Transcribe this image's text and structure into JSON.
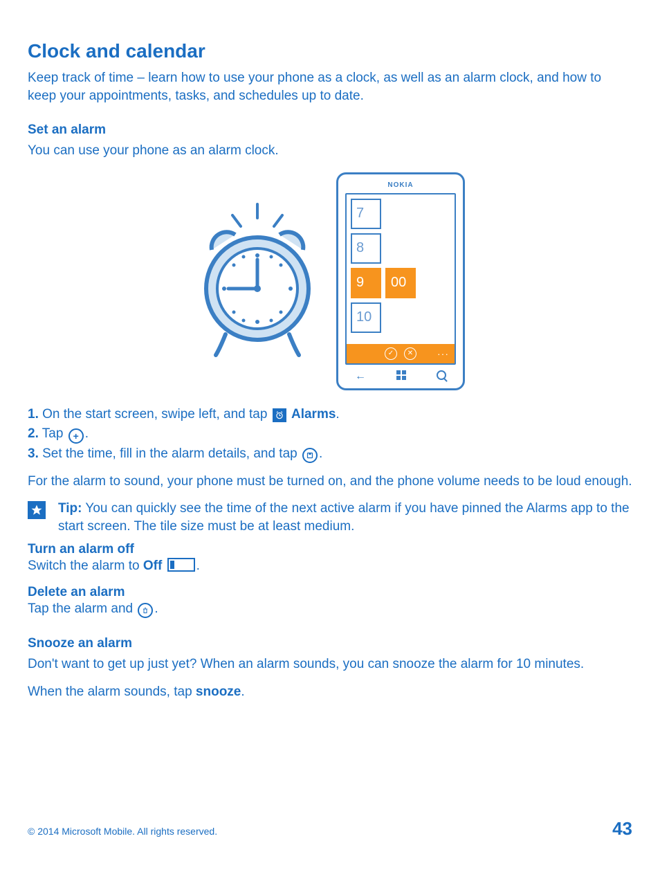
{
  "h1": "Clock and calendar",
  "intro": "Keep track of time – learn how to use your phone as a clock, as well as an alarm clock, and how to keep your appointments, tasks, and schedules up to date.",
  "set_alarm": {
    "heading": "Set an alarm",
    "lead": "You can use your phone as an alarm clock.",
    "step1_num": "1.",
    "step1_a": " On the start screen, swipe left, and tap ",
    "step1_b": "Alarms",
    "step1_c": ".",
    "step2_num": "2.",
    "step2_a": " Tap ",
    "step2_c": ".",
    "step3_num": "3.",
    "step3_a": " Set the time, fill in the alarm details, and tap ",
    "step3_c": ".",
    "note": "For the alarm to sound, your phone must be turned on, and the phone volume needs to be loud enough.",
    "tip_label": "Tip:",
    "tip_body": " You can quickly see the time of the next active alarm if you have pinned the Alarms app to the start screen. The tile size must be at least medium."
  },
  "turn_off": {
    "heading": "Turn an alarm off",
    "body_a": "Switch the alarm to ",
    "body_b": "Off",
    "body_c": " ",
    "body_d": "."
  },
  "delete": {
    "heading": "Delete an alarm",
    "body_a": "Tap the alarm and ",
    "body_c": "."
  },
  "snooze": {
    "heading": "Snooze an alarm",
    "p1": "Don't want to get up just yet? When an alarm sounds, you can snooze the alarm for 10 minutes.",
    "p2_a": "When the alarm sounds, tap ",
    "p2_b": "snooze",
    "p2_c": "."
  },
  "phone": {
    "brand": "NOKIA",
    "n7": "7",
    "n8": "8",
    "n9": "9",
    "n00": "00",
    "n10": "10"
  },
  "footer": {
    "copy": "© 2014 Microsoft Mobile. All rights reserved.",
    "page": "43"
  }
}
